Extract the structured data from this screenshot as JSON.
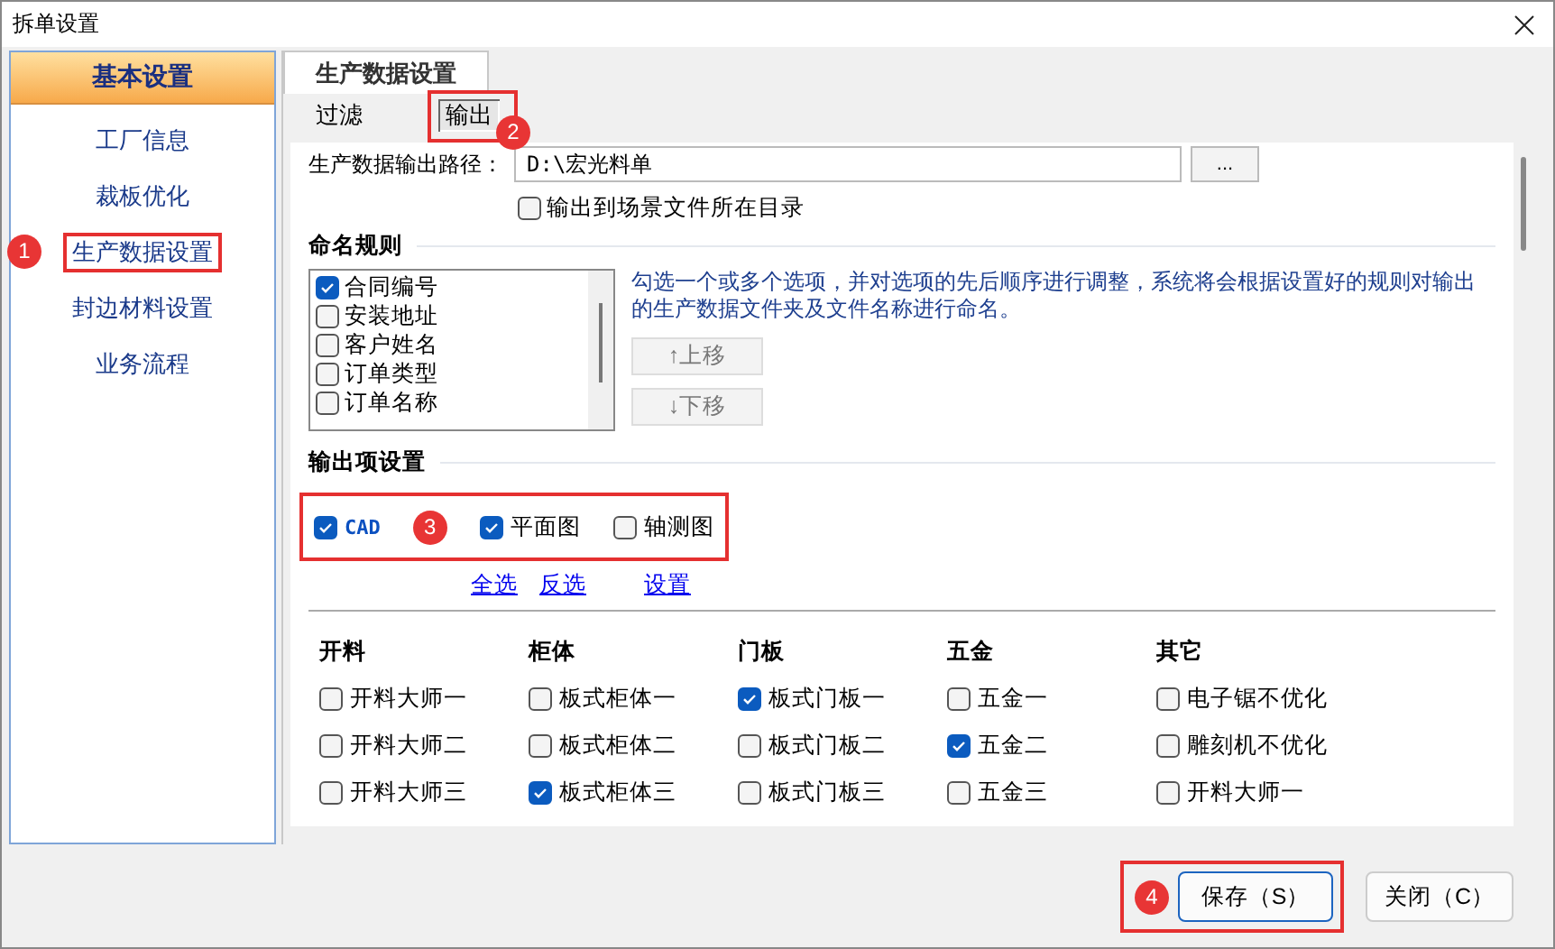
{
  "window": {
    "title": "拆单设置"
  },
  "sidebar": {
    "header": "基本设置",
    "items": [
      {
        "label": "工厂信息",
        "highlighted": false
      },
      {
        "label": "裁板优化",
        "highlighted": false
      },
      {
        "label": "生产数据设置",
        "highlighted": true,
        "badge": "1"
      },
      {
        "label": "封边材料设置",
        "highlighted": false
      },
      {
        "label": "业务流程",
        "highlighted": false
      }
    ]
  },
  "tab": {
    "label": "生产数据设置",
    "selected": true
  },
  "subtabs": [
    {
      "label": "过滤",
      "selected": false,
      "highlighted": false
    },
    {
      "label": "输出",
      "selected": true,
      "highlighted": true,
      "badge": "2"
    }
  ],
  "output_path": {
    "label": "生产数据输出路径：",
    "value": "D:\\宏光料单",
    "browse": "..."
  },
  "scene_dir": {
    "label": "输出到场景文件所在目录",
    "checked": false
  },
  "naming": {
    "title": "命名规则",
    "items": [
      {
        "label": "合同编号",
        "checked": true
      },
      {
        "label": "安装地址",
        "checked": false
      },
      {
        "label": "客户姓名",
        "checked": false
      },
      {
        "label": "订单类型",
        "checked": false
      },
      {
        "label": "订单名称",
        "checked": false
      }
    ],
    "hint": "勾选一个或多个选项，并对选项的先后顺序进行调整，系统将会根据设置好的规则对输出的生产数据文件夹及文件名称进行命名。",
    "move_up": "↑上移",
    "move_down": "↓下移"
  },
  "output": {
    "title": "输出项设置",
    "highlighted": true,
    "badge": "3",
    "types": [
      {
        "label": "CAD",
        "checked": true,
        "bold": true
      },
      {
        "label": "平面图",
        "checked": true,
        "bold": false
      },
      {
        "label": "轴测图",
        "checked": false,
        "bold": false
      }
    ],
    "links": [
      "全选",
      "反选",
      "设置"
    ],
    "groups": [
      {
        "title": "开料",
        "items": [
          {
            "label": "开料大师一",
            "checked": false
          },
          {
            "label": "开料大师二",
            "checked": false
          },
          {
            "label": "开料大师三",
            "checked": false
          }
        ]
      },
      {
        "title": "柜体",
        "items": [
          {
            "label": "板式柜体一",
            "checked": false
          },
          {
            "label": "板式柜体二",
            "checked": false
          },
          {
            "label": "板式柜体三",
            "checked": true
          }
        ]
      },
      {
        "title": "门板",
        "items": [
          {
            "label": "板式门板一",
            "checked": true
          },
          {
            "label": "板式门板二",
            "checked": false
          },
          {
            "label": "板式门板三",
            "checked": false
          }
        ]
      },
      {
        "title": "五金",
        "items": [
          {
            "label": "五金一",
            "checked": false
          },
          {
            "label": "五金二",
            "checked": true
          },
          {
            "label": "五金三",
            "checked": false
          }
        ]
      },
      {
        "title": "其它",
        "items": [
          {
            "label": "电子锯不优化",
            "checked": false
          },
          {
            "label": "雕刻机不优化",
            "checked": false
          },
          {
            "label": "开料大师一",
            "checked": false
          }
        ]
      }
    ]
  },
  "buttons": [
    {
      "label": "保存（S）",
      "kind": "primary",
      "highlighted": true,
      "badge": "4"
    },
    {
      "label": "关闭（C）",
      "kind": "normal",
      "highlighted": false
    }
  ]
}
